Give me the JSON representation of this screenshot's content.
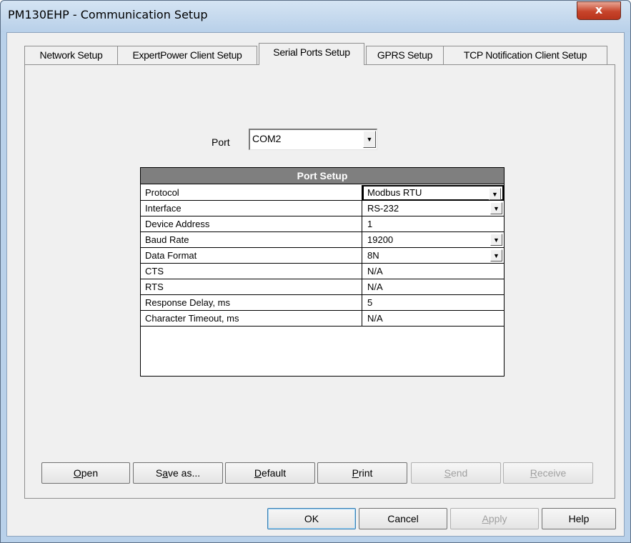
{
  "window": {
    "title": "PM130EHP - Communication Setup",
    "close_glyph": "x"
  },
  "tabs": [
    {
      "label": "Network Setup",
      "active": false
    },
    {
      "label": "ExpertPower Client Setup",
      "active": false
    },
    {
      "label": "Serial Ports Setup",
      "active": true
    },
    {
      "label": "GPRS Setup",
      "active": false
    },
    {
      "label": "TCP Notification Client Setup",
      "active": false
    }
  ],
  "port": {
    "label": "Port",
    "value": "COM2"
  },
  "port_setup": {
    "header": "Port Setup",
    "rows": [
      {
        "name": "Protocol",
        "value": "Modbus RTU",
        "dropdown": true
      },
      {
        "name": "Interface",
        "value": "RS-232",
        "dropdown": true
      },
      {
        "name": "Device Address",
        "value": "1",
        "dropdown": false
      },
      {
        "name": "Baud Rate",
        "value": "19200",
        "dropdown": true
      },
      {
        "name": "Data Format",
        "value": "8N",
        "dropdown": true
      },
      {
        "name": "CTS",
        "value": "N/A",
        "dropdown": false
      },
      {
        "name": "RTS",
        "value": "N/A",
        "dropdown": false
      },
      {
        "name": "Response Delay, ms",
        "value": "5",
        "dropdown": false
      },
      {
        "name": "Character Timeout, ms",
        "value": "N/A",
        "dropdown": false
      }
    ]
  },
  "actions": {
    "open": {
      "accel": "O",
      "rest": "pen"
    },
    "save_as": {
      "pre": "S",
      "accel": "a",
      "rest": "ve as..."
    },
    "default": {
      "accel": "D",
      "rest": "efault"
    },
    "print": {
      "accel": "P",
      "rest": "rint"
    },
    "send": {
      "accel": "S",
      "rest": "end"
    },
    "receive": {
      "accel": "R",
      "rest": "eceive"
    }
  },
  "dialog_buttons": {
    "ok": "OK",
    "cancel": "Cancel",
    "apply": {
      "accel": "A",
      "rest": "pply"
    },
    "help": "Help"
  },
  "icons": {
    "dropdown": "chevron-down-icon",
    "close": "close-icon"
  }
}
